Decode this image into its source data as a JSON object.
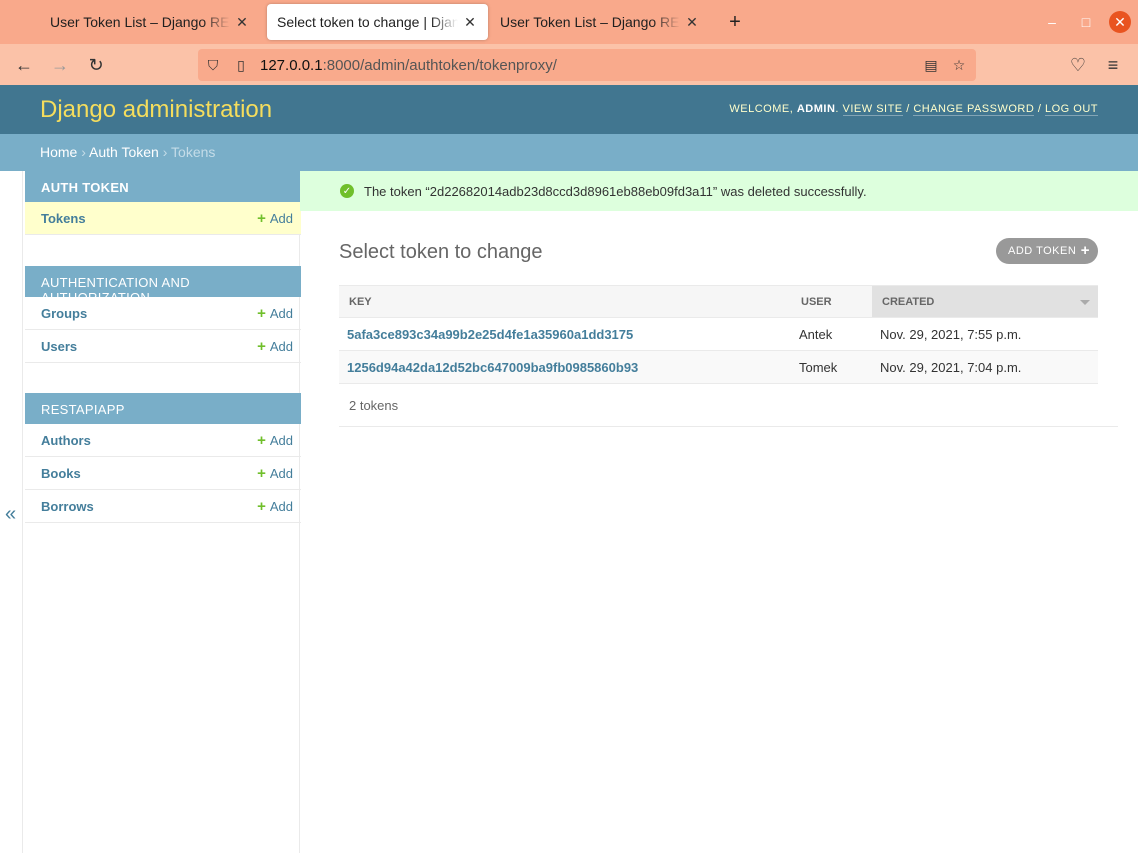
{
  "browser": {
    "tabs": [
      {
        "title": "User Token List – Django REST framework",
        "active": false
      },
      {
        "title": "Select token to change | Django site admin",
        "active": true
      },
      {
        "title": "User Token List – Django REST framework",
        "active": false
      }
    ],
    "url_host": "127.0.0.1",
    "url_rest": ":8000/admin/authtoken/tokenproxy/"
  },
  "header": {
    "branding": "Django administration",
    "welcome": "Welcome, ",
    "username": "admin",
    "view_site": "View site",
    "change_password": "Change password",
    "log_out": "Log out"
  },
  "breadcrumbs": {
    "home": "Home",
    "app": "Auth Token",
    "current": "Tokens"
  },
  "sidebar": {
    "modules": [
      {
        "caption": "Auth Token",
        "models": [
          {
            "name": "Tokens",
            "add": "Add"
          }
        ]
      },
      {
        "caption": "Authentication and Authorization",
        "models": [
          {
            "name": "Groups",
            "add": "Add"
          },
          {
            "name": "Users",
            "add": "Add"
          }
        ]
      },
      {
        "caption": "Restapiapp",
        "models": [
          {
            "name": "Authors",
            "add": "Add"
          },
          {
            "name": "Books",
            "add": "Add"
          },
          {
            "name": "Borrows",
            "add": "Add"
          }
        ]
      }
    ],
    "toggle": "«"
  },
  "message": "The token “2d22682014adb23d8ccd3d8961eb88eb09fd3a11” was deleted successfully.",
  "content": {
    "title": "Select token to change",
    "add_button": "Add token",
    "columns": [
      "Key",
      "User",
      "Created"
    ],
    "rows": [
      {
        "key": "5afa3ce893c34a99b2e25d4fe1a35960a1dd3175",
        "user": "Antek",
        "created": "Nov. 29, 2021, 7:55 p.m."
      },
      {
        "key": "1256d94a42da12d52bc647009ba9fb0985860b93",
        "user": "Tomek",
        "created": "Nov. 29, 2021, 7:04 p.m."
      }
    ],
    "paginator": "2 tokens"
  }
}
